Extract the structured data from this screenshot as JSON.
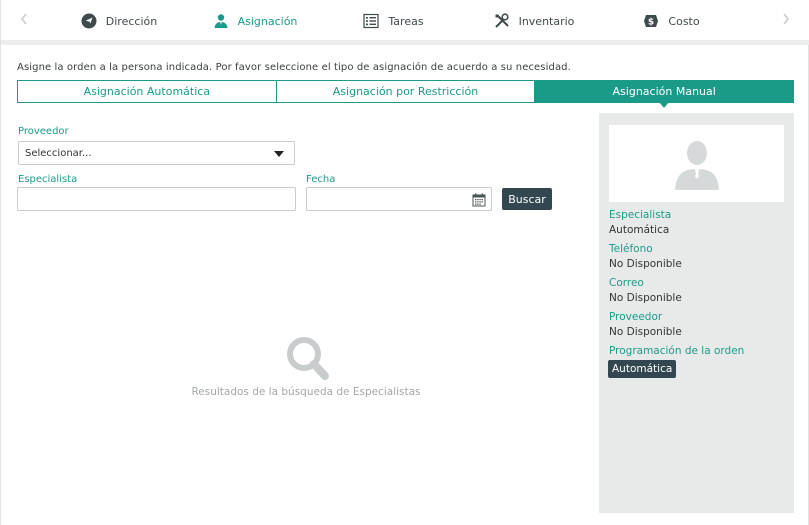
{
  "tabs": [
    {
      "label": "Dirección",
      "icon": "navigation-arrow-icon"
    },
    {
      "label": "Asignación",
      "icon": "person-icon"
    },
    {
      "label": "Tareas",
      "icon": "task-list-icon"
    },
    {
      "label": "Inventario",
      "icon": "tools-icon"
    },
    {
      "label": "Costo",
      "icon": "dollar-tag-icon"
    }
  ],
  "active_tab": "Asignación",
  "instruction": "Asigne la orden a la persona indicada. Por favor seleccione el tipo de asignación de acuerdo a su necesidad.",
  "segments": [
    "Asignación Automática",
    "Asignación por Restricción",
    "Asignación Manual"
  ],
  "active_segment": "Asignación Manual",
  "form": {
    "provider_label": "Proveedor",
    "provider_value": "Seleccionar...",
    "specialist_label": "Especialista",
    "specialist_value": "",
    "date_label": "Fecha",
    "date_value": "",
    "search_button": "Buscar"
  },
  "results": {
    "empty_text": "Resultados de la búsqueda de Especialistas",
    "icon": "search-icon"
  },
  "panel": {
    "specialist_label": "Especialista",
    "specialist_value": "Automática",
    "phone_label": "Teléfono",
    "phone_value": "No Disponible",
    "email_label": "Correo",
    "email_value": "No Disponible",
    "provider_label": "Proveedor",
    "provider_value": "No Disponible",
    "schedule_label": "Programación de la orden",
    "schedule_value": "Automática"
  },
  "colors": {
    "accent": "#1a9b8a",
    "dark_button": "#324750",
    "panel_bg": "#e8eaea"
  }
}
